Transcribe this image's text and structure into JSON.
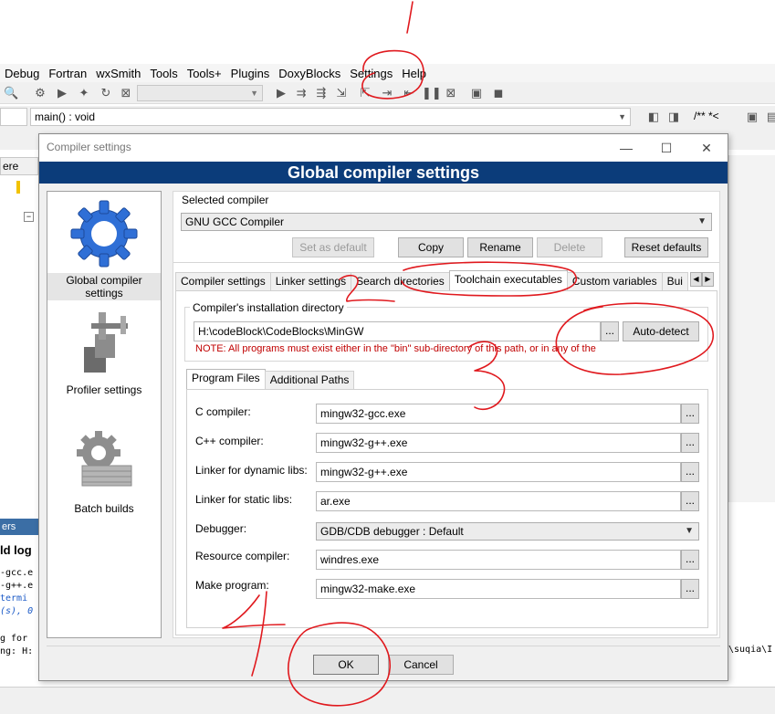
{
  "ide": {
    "menu": [
      "Debug",
      "Fortran",
      "wxSmith",
      "Tools",
      "Tools+",
      "Plugins",
      "DoxyBlocks",
      "Settings",
      "Help"
    ],
    "function_combo": "main() : void",
    "left_tab_label": "ere",
    "bottom_header": "ers",
    "build_log_tab": "ld log",
    "log_lines": [
      "-gcc.e",
      "-g++.e",
      " termi",
      "(s), 0",
      "g for",
      "ng: H:"
    ],
    "log_right": "\\suqia\\I",
    "toolbar_text": "/** *<"
  },
  "dialog": {
    "title": "Compiler settings",
    "banner": "Global compiler settings",
    "window_buttons": {
      "minimize": "—",
      "maximize": "☐",
      "close": "✕"
    },
    "left_panel": [
      {
        "label": "Global compiler settings",
        "icon": "gear-icon",
        "selected": true
      },
      {
        "label": "Profiler settings",
        "icon": "vise-icon",
        "selected": false
      },
      {
        "label": "Batch builds",
        "icon": "gear-stack-icon",
        "selected": false
      }
    ],
    "selected_compiler": {
      "label": "Selected compiler",
      "value": "GNU GCC Compiler",
      "buttons": {
        "set_default": "Set as default",
        "copy": "Copy",
        "rename": "Rename",
        "delete": "Delete",
        "reset": "Reset defaults"
      }
    },
    "tabs": [
      "Compiler settings",
      "Linker settings",
      "Search directories",
      "Toolchain executables",
      "Custom variables",
      "Bui"
    ],
    "install_dir": {
      "label": "Compiler's installation directory",
      "value": "H:\\codeBlock\\CodeBlocks\\MinGW",
      "browse": "...",
      "autodetect": "Auto-detect",
      "note": "NOTE: All programs must exist either in the \"bin\" sub-directory of this path, or in any of the"
    },
    "sub_tabs": [
      "Program Files",
      "Additional Paths"
    ],
    "programs": [
      {
        "label": "C compiler:",
        "value": "mingw32-gcc.exe",
        "type": "text"
      },
      {
        "label": "C++ compiler:",
        "value": "mingw32-g++.exe",
        "type": "text"
      },
      {
        "label": "Linker for dynamic libs:",
        "value": "mingw32-g++.exe",
        "type": "text"
      },
      {
        "label": "Linker for static libs:",
        "value": "ar.exe",
        "type": "text"
      },
      {
        "label": "Debugger:",
        "value": "GDB/CDB debugger : Default",
        "type": "select"
      },
      {
        "label": "Resource compiler:",
        "value": "windres.exe",
        "type": "text"
      },
      {
        "label": "Make program:",
        "value": "mingw32-make.exe",
        "type": "text"
      }
    ],
    "browse_label": "...",
    "ok": "OK",
    "cancel": "Cancel"
  },
  "colors": {
    "banner": "#0b3c7a",
    "note": "#c00000",
    "annotation": "#e0191e"
  }
}
